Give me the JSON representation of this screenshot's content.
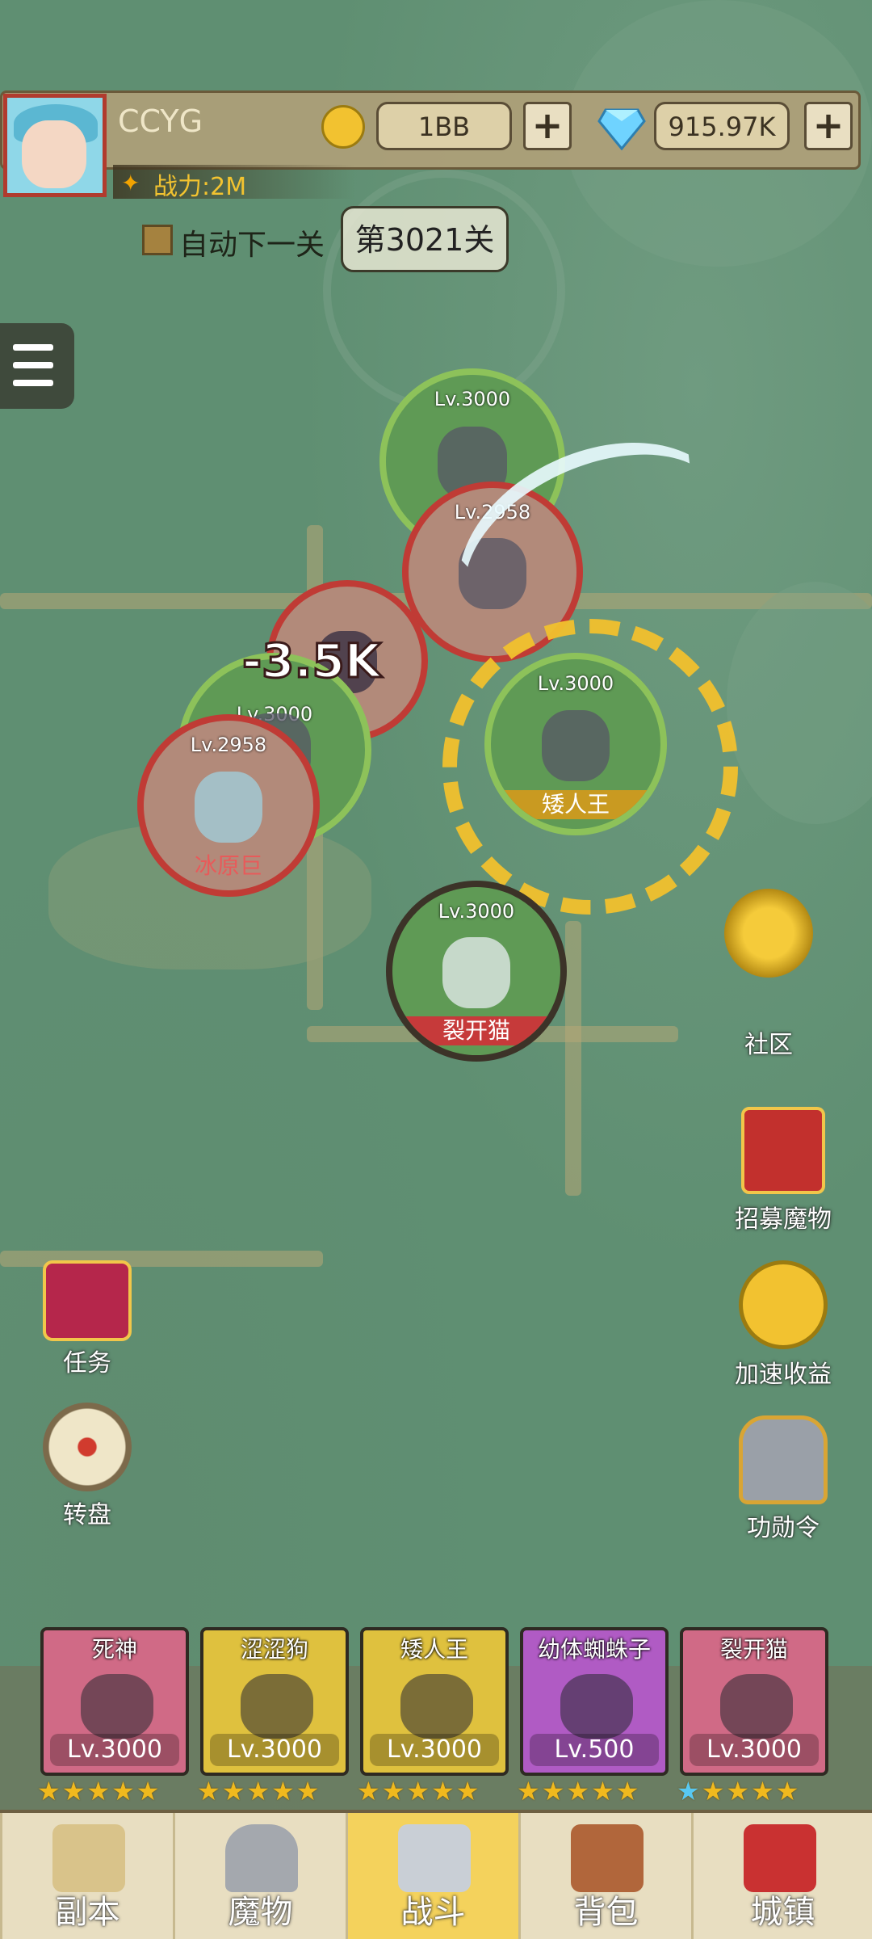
{
  "player": {
    "name": "CCYG",
    "power": "战力:2M"
  },
  "resources": {
    "gold": "1BB",
    "diamonds": "915.97K"
  },
  "stage": {
    "auto_next_label": "自动下一关",
    "current": "第3021关"
  },
  "battle": {
    "damage": "-3.5K",
    "units": [
      {
        "level": "Lv.3000"
      },
      {
        "level": "Lv.2958"
      },
      {
        "level": "Lv.3000"
      },
      {
        "level": "Lv.2958",
        "name": "冰原巨"
      },
      {
        "level": "Lv.3000",
        "name": "矮人王"
      },
      {
        "level": "Lv.3000",
        "name": "裂开猫"
      }
    ]
  },
  "side_buttons": {
    "community": "社区",
    "recruit": "招募魔物",
    "speed_income": "加速收益",
    "merit": "功勋令",
    "quest": "任务",
    "wheel": "转盘"
  },
  "formation": [
    {
      "name": "死神",
      "level": "Lv.3000"
    },
    {
      "name": "涩涩狗",
      "level": "Lv.3000"
    },
    {
      "name": "矮人王",
      "level": "Lv.3000"
    },
    {
      "name": "幼体蜘蛛子",
      "level": "Lv.500"
    },
    {
      "name": "裂开猫",
      "level": "Lv.3000"
    }
  ],
  "nav": [
    "副本",
    "魔物",
    "战斗",
    "背包",
    "城镇"
  ]
}
